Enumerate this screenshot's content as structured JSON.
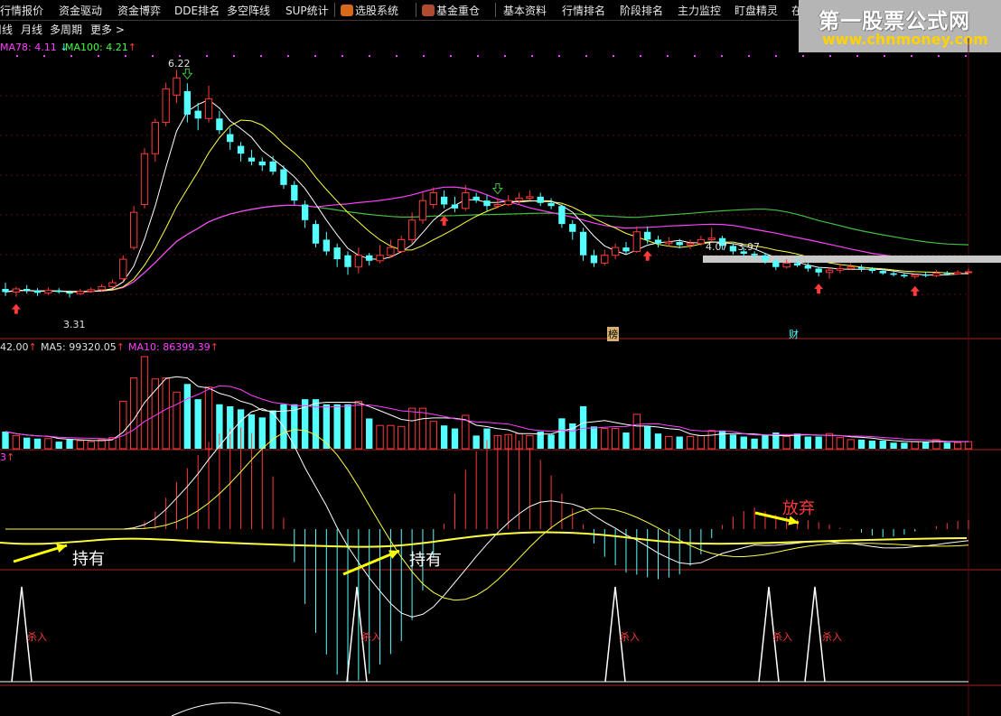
{
  "menubar": {
    "items": [
      {
        "id": "hqbj",
        "label": "行情报价"
      },
      {
        "id": "zjqd",
        "label": "资金驱动"
      },
      {
        "id": "zjby",
        "label": "资金博弈"
      },
      {
        "id": "dde",
        "label": "DDE排名"
      },
      {
        "id": "dkzx",
        "label": "多空阵线"
      },
      {
        "id": "sup",
        "label": "SUP统计"
      },
      {
        "id": "xgxt",
        "label": "选股系统"
      },
      {
        "id": "jjzc",
        "label": "基金重仓"
      },
      {
        "id": "jbzl",
        "label": "基本资料"
      },
      {
        "id": "hqpm",
        "label": "行情排名"
      },
      {
        "id": "jdpm",
        "label": "阶段排名"
      },
      {
        "id": "zljk",
        "label": "主力监控"
      },
      {
        "id": "dpjl",
        "label": "盯盘精灵"
      },
      {
        "id": "more",
        "label": "在"
      }
    ]
  },
  "subbar": {
    "items": [
      {
        "id": "week",
        "label": "周线"
      },
      {
        "id": "month",
        "label": "月线"
      },
      {
        "id": "multi",
        "label": "多周期"
      },
      {
        "id": "more",
        "label": "更多 >"
      }
    ]
  },
  "watermark": {
    "title": "第一股票公式网",
    "url": "www.chnmoney.com"
  },
  "price_panel": {
    "ma78_label": "MA78: 4.11",
    "ma78_arrow": "↓",
    "ma100_label": "MA100: 4.21",
    "ma100_arrow": "↑",
    "high_label": "6.22",
    "low_label": "3.31",
    "range_label": "4.07 - 3.97",
    "badge_bang": "榜",
    "badge_cai": "财"
  },
  "volume_panel": {
    "vol_label": "42.00",
    "ma5_label": "MA5: 99320.05",
    "ma10_label": "MA10: 86399.39"
  },
  "macd_panel": {
    "label": "3",
    "hold_text": "持有",
    "giveup_text": "放弃"
  },
  "signal_panel": {
    "kill_text": "杀入"
  },
  "colors": {
    "up": "#ff3a3a",
    "down": "#54ffff",
    "ma_white": "#ffffff",
    "ma_yellow": "#ffff40",
    "ma_purple": "#ff40ff",
    "ma_green": "#40c040",
    "annotation": "#ff3a3a",
    "arrow": "#ffff00",
    "watermark_bg": "#b5b5b5",
    "watermark_url": "#ffd200"
  },
  "chart_data": {
    "type": "candlestick",
    "title": "",
    "xlabel": "",
    "ylabel": "",
    "ylim": [
      2.9,
      6.4
    ],
    "high_marker": 6.22,
    "low_marker": 3.31,
    "candles": [
      [
        3.42,
        3.38,
        3.5,
        3.33
      ],
      [
        3.38,
        3.42,
        3.45,
        3.32
      ],
      [
        3.42,
        3.4,
        3.47,
        3.36
      ],
      [
        3.4,
        3.37,
        3.43,
        3.33
      ],
      [
        3.37,
        3.4,
        3.44,
        3.34
      ],
      [
        3.4,
        3.38,
        3.43,
        3.36
      ],
      [
        3.38,
        3.36,
        3.4,
        3.31
      ],
      [
        3.36,
        3.39,
        3.42,
        3.34
      ],
      [
        3.39,
        3.41,
        3.44,
        3.37
      ],
      [
        3.41,
        3.45,
        3.48,
        3.39
      ],
      [
        3.45,
        3.5,
        3.54,
        3.43
      ],
      [
        3.55,
        3.8,
        3.85,
        3.52
      ],
      [
        3.95,
        4.4,
        4.48,
        3.92
      ],
      [
        4.5,
        5.15,
        5.22,
        4.45
      ],
      [
        5.15,
        5.55,
        5.6,
        5.05
      ],
      [
        5.55,
        5.98,
        6.06,
        5.5
      ],
      [
        5.9,
        6.12,
        6.22,
        5.8
      ],
      [
        5.95,
        5.65,
        6.05,
        5.55
      ],
      [
        5.7,
        5.6,
        5.8,
        5.45
      ],
      [
        5.6,
        5.85,
        6.02,
        5.55
      ],
      [
        5.6,
        5.45,
        5.7,
        5.4
      ],
      [
        5.4,
        5.3,
        5.48,
        5.2
      ],
      [
        5.25,
        5.15,
        5.3,
        5.05
      ],
      [
        5.1,
        5.05,
        5.2,
        5.0
      ],
      [
        5.05,
        5.0,
        5.1,
        4.93
      ],
      [
        5.05,
        4.92,
        5.12,
        4.88
      ],
      [
        4.95,
        4.75,
        5.0,
        4.7
      ],
      [
        4.75,
        4.55,
        4.8,
        4.5
      ],
      [
        4.5,
        4.3,
        4.55,
        4.2
      ],
      [
        4.25,
        4.0,
        4.3,
        3.95
      ],
      [
        4.05,
        3.9,
        4.15,
        3.85
      ],
      [
        3.95,
        3.8,
        4.0,
        3.7
      ],
      [
        3.85,
        3.7,
        3.9,
        3.6
      ],
      [
        3.7,
        3.85,
        3.95,
        3.62
      ],
      [
        3.85,
        3.78,
        3.88,
        3.72
      ],
      [
        3.78,
        3.85,
        3.98,
        3.75
      ],
      [
        3.85,
        3.95,
        4.05,
        3.82
      ],
      [
        3.9,
        4.05,
        4.1,
        3.88
      ],
      [
        4.05,
        4.3,
        4.4,
        4.0
      ],
      [
        4.3,
        4.55,
        4.65,
        4.25
      ],
      [
        4.5,
        4.65,
        4.72,
        4.45
      ],
      [
        4.6,
        4.5,
        4.68,
        4.45
      ],
      [
        4.5,
        4.45,
        4.6,
        4.4
      ],
      [
        4.45,
        4.65,
        4.75,
        4.42
      ],
      [
        4.6,
        4.55,
        4.65,
        4.52
      ],
      [
        4.55,
        4.48,
        4.62,
        4.42
      ],
      [
        4.48,
        4.5,
        4.58,
        4.45
      ],
      [
        4.5,
        4.55,
        4.62,
        4.48
      ],
      [
        4.55,
        4.58,
        4.65,
        4.5
      ],
      [
        4.58,
        4.6,
        4.68,
        4.55
      ],
      [
        4.6,
        4.52,
        4.65,
        4.48
      ],
      [
        4.52,
        4.48,
        4.58,
        4.44
      ],
      [
        4.48,
        4.25,
        4.5,
        4.2
      ],
      [
        4.25,
        4.15,
        4.3,
        4.05
      ],
      [
        4.15,
        3.85,
        4.2,
        3.78
      ],
      [
        3.85,
        3.75,
        3.92,
        3.7
      ],
      [
        3.75,
        3.85,
        3.92,
        3.72
      ],
      [
        3.85,
        3.95,
        4.0,
        3.8
      ],
      [
        3.95,
        3.9,
        4.02,
        3.86
      ],
      [
        3.9,
        4.15,
        4.22,
        3.88
      ],
      [
        4.15,
        4.05,
        4.22,
        4.0
      ],
      [
        4.05,
        4.0,
        4.1,
        3.95
      ],
      [
        4.0,
        4.02,
        4.08,
        3.96
      ],
      [
        4.02,
        3.98,
        4.06,
        3.94
      ],
      [
        3.98,
        4.0,
        4.05,
        3.93
      ],
      [
        4.0,
        4.05,
        4.1,
        3.97
      ],
      [
        4.05,
        4.07,
        4.2,
        4.02
      ],
      [
        4.07,
        3.97,
        4.1,
        3.92
      ],
      [
        3.97,
        3.9,
        4.0,
        3.86
      ],
      [
        3.9,
        3.87,
        3.95,
        3.83
      ],
      [
        3.87,
        3.85,
        3.9,
        3.8
      ],
      [
        3.85,
        3.78,
        3.88,
        3.74
      ],
      [
        3.78,
        3.7,
        3.82,
        3.66
      ],
      [
        3.7,
        3.75,
        3.8,
        3.68
      ],
      [
        3.75,
        3.72,
        3.85,
        3.7
      ],
      [
        3.72,
        3.68,
        3.76,
        3.64
      ],
      [
        3.68,
        3.63,
        3.7,
        3.58
      ],
      [
        3.63,
        3.66,
        3.7,
        3.55
      ],
      [
        3.66,
        3.68,
        3.73,
        3.62
      ],
      [
        3.68,
        3.7,
        3.75,
        3.66
      ],
      [
        3.7,
        3.68,
        3.73,
        3.64
      ],
      [
        3.68,
        3.65,
        3.7,
        3.62
      ],
      [
        3.65,
        3.62,
        3.68,
        3.6
      ],
      [
        3.62,
        3.6,
        3.64,
        3.58
      ],
      [
        3.6,
        3.58,
        3.62,
        3.56
      ],
      [
        3.58,
        3.6,
        3.62,
        3.55
      ],
      [
        3.6,
        3.59,
        3.64,
        3.57
      ],
      [
        3.59,
        3.62,
        3.66,
        3.57
      ],
      [
        3.62,
        3.61,
        3.65,
        3.59
      ],
      [
        3.61,
        3.63,
        3.66,
        3.6
      ],
      [
        3.63,
        3.64,
        3.68,
        3.61
      ]
    ]
  }
}
